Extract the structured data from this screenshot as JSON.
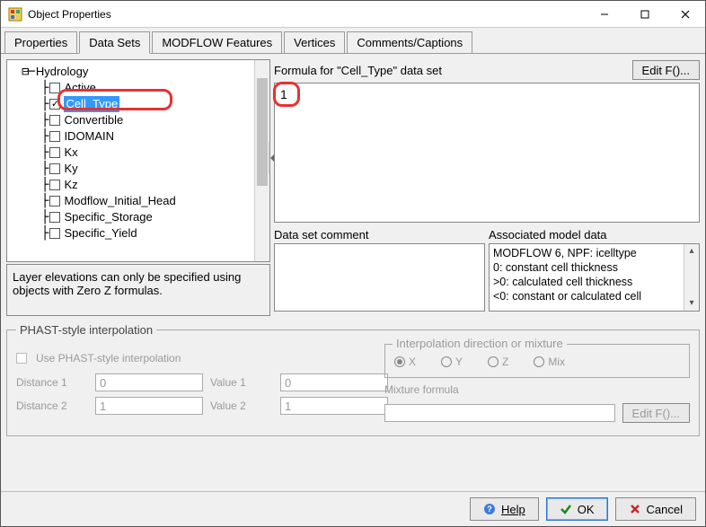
{
  "window": {
    "title": "Object Properties"
  },
  "tabs": {
    "properties": "Properties",
    "datasets": "Data Sets",
    "modflow": "MODFLOW Features",
    "vertices": "Vertices",
    "comments": "Comments/Captions"
  },
  "tree": {
    "root": "Hydrology",
    "items": [
      {
        "label": "Active",
        "checked": false
      },
      {
        "label": "Cell_Type",
        "checked": true,
        "selected": true
      },
      {
        "label": "Convertible",
        "checked": false
      },
      {
        "label": "IDOMAIN",
        "checked": false
      },
      {
        "label": "Kx",
        "checked": false
      },
      {
        "label": "Ky",
        "checked": false
      },
      {
        "label": "Kz",
        "checked": false
      },
      {
        "label": "Modflow_Initial_Head",
        "checked": false
      },
      {
        "label": "Specific_Storage",
        "checked": false
      },
      {
        "label": "Specific_Yield",
        "checked": false
      }
    ]
  },
  "hint": "Layer elevations can only be specified using objects with Zero Z formulas.",
  "formula": {
    "label": "Formula for \"Cell_Type\" data set",
    "edit_btn": "Edit F()...",
    "value": "1"
  },
  "comment": {
    "label": "Data set comment",
    "value": ""
  },
  "assoc": {
    "label": "Associated model data",
    "lines": [
      "MODFLOW 6, NPF: icelltype",
      "0: constant cell thickness",
      ">0: calculated cell thickness",
      "<0: constant or calculated cell"
    ]
  },
  "phast": {
    "group_label": "PHAST-style interpolation",
    "use_label": "Use PHAST-style interpolation",
    "distance1_label": "Distance 1",
    "distance1_value": "0",
    "value1_label": "Value 1",
    "value1_value": "0",
    "distance2_label": "Distance 2",
    "distance2_value": "1",
    "value2_label": "Value 2",
    "value2_value": "1",
    "interp_label": "Interpolation direction or mixture",
    "rx": "X",
    "ry": "Y",
    "rz": "Z",
    "rmix": "Mix",
    "mixture_label": "Mixture formula",
    "editf": "Edit F()..."
  },
  "buttons": {
    "help": "Help",
    "ok": "OK",
    "cancel": "Cancel"
  }
}
